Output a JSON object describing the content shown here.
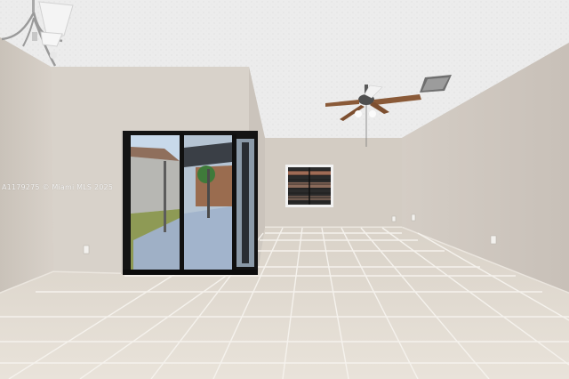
{
  "photo": {
    "subject": "empty-living-room",
    "watermark": "A1179275 © Miami MLS 2025"
  },
  "colors": {
    "ceiling": "#eeeeee",
    "wall": "#d6cfc8",
    "wall_shadow": "#c9c2ba",
    "floor": "#e2dbd2",
    "grout": "#f4f1ec",
    "door_frame": "#141414",
    "fan_blade": "#8a5a38"
  }
}
